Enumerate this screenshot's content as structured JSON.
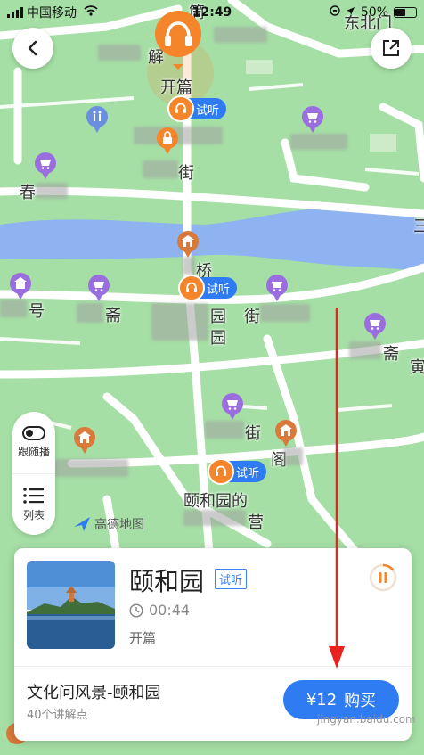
{
  "status_bar": {
    "carrier": "中国移动",
    "time": "12:49",
    "battery": "50%",
    "battery_level": 0.5
  },
  "map": {
    "labels": {
      "pin_main": "开篇",
      "label_chun": "春",
      "label_hao": "号",
      "label_zhai1": "斋",
      "label_yuan": "园",
      "label_yuan2": "园",
      "label_jie": "街",
      "label_zhai2": "斋",
      "label_yin": "寅",
      "label_jie2": "街",
      "label_qiao": "桥",
      "label_jie3": "街",
      "label_you": "颐和园的",
      "label_ying": "营",
      "label_san": "三",
      "label_ge": "阁",
      "label_bei": "东北门",
      "label_xie": "解",
      "label_tong": "筒"
    },
    "listen_tags": [
      "试听",
      "试听",
      "试听"
    ]
  },
  "side_panel": {
    "follow_label": "跟随播",
    "list_label": "列表"
  },
  "map_logo": "高德地图",
  "card": {
    "title": "颐和园",
    "trial": "试听",
    "duration": "00:44",
    "chapter": "开篇",
    "tour_name": "文化问风景-颐和园",
    "points": "40个讲解点",
    "price": "¥12",
    "buy": "购买",
    "playback_progress": 0.15
  },
  "watermark": "jingyan.baidu.com",
  "colors": {
    "map_bg": "#a5dfa5",
    "water": "#8fb3f0",
    "road": "#ffffff",
    "accent_blue": "#2f7bf1",
    "accent_orange": "#f5852a",
    "poi_purple": "#9b6ee0",
    "arrow_red": "#e8231f"
  }
}
